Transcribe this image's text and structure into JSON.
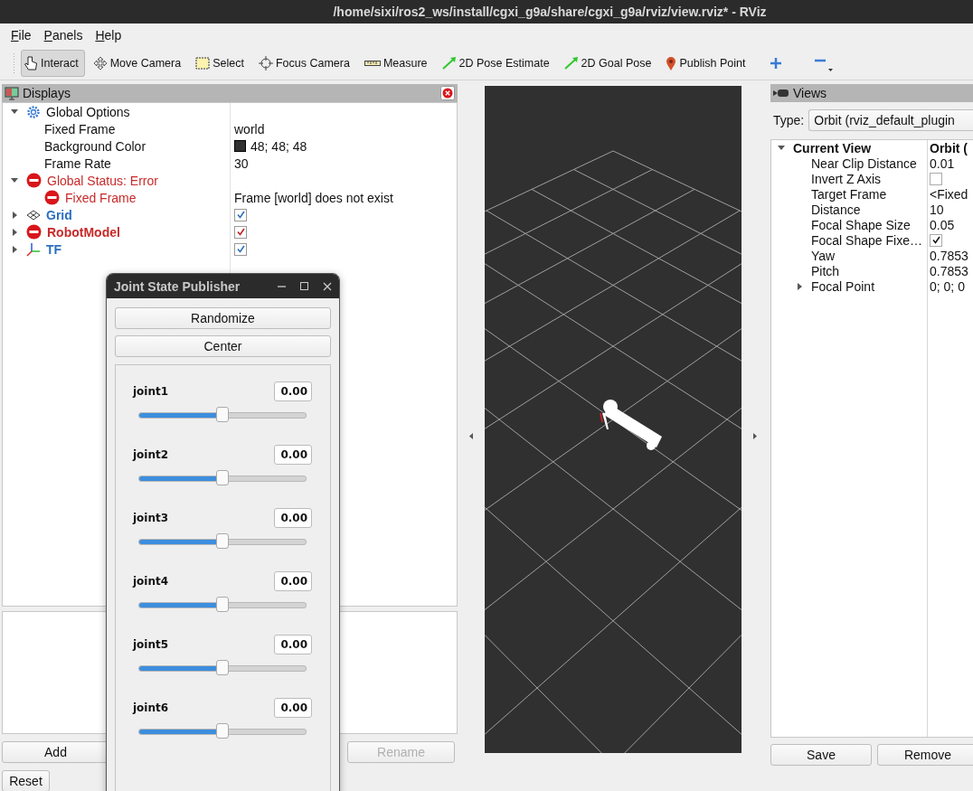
{
  "window": {
    "title": "/home/sixi/ros2_ws/install/cgxi_g9a/share/cgxi_g9a/rviz/view.rviz* - RViz"
  },
  "menu": [
    "File",
    "Panels",
    "Help"
  ],
  "tools": [
    {
      "label": "Interact",
      "kind": "interact",
      "selected": true
    },
    {
      "label": "Move Camera",
      "kind": "move_camera",
      "selected": false
    },
    {
      "label": "Select",
      "kind": "select",
      "selected": false
    },
    {
      "label": "Focus Camera",
      "kind": "focus_camera",
      "selected": false
    },
    {
      "label": "Measure",
      "kind": "measure",
      "selected": false
    },
    {
      "label": "2D Pose Estimate",
      "kind": "pose",
      "selected": false
    },
    {
      "label": "2D Goal Pose",
      "kind": "pose",
      "selected": false
    },
    {
      "label": "Publish Point",
      "kind": "point",
      "selected": false
    }
  ],
  "displays": {
    "title": "Displays",
    "tree": [
      {
        "name": "Global Options",
        "kind": "options",
        "expanded": true,
        "children": [
          {
            "name": "Fixed Frame",
            "value": "world"
          },
          {
            "name": "Background Color",
            "value": "48; 48; 48",
            "color": "#303030"
          },
          {
            "name": "Frame Rate",
            "value": "30"
          }
        ]
      },
      {
        "name": "Global Status: Error",
        "kind": "status",
        "error": true,
        "expanded": true,
        "children": [
          {
            "name": "Fixed Frame",
            "kind": "status",
            "error": true,
            "value": "Frame [world] does not exist"
          }
        ]
      },
      {
        "name": "Grid",
        "kind": "grid",
        "error": false,
        "expanded": false,
        "checked": true
      },
      {
        "name": "RobotModel",
        "kind": "robot_model",
        "error": true,
        "expanded": false,
        "checked": true
      },
      {
        "name": "TF",
        "kind": "tf",
        "error": false,
        "expanded": false,
        "checked": true
      }
    ],
    "buttons": [
      {
        "label": "Add",
        "disabled": false
      },
      {
        "label": "Rename",
        "disabled": true
      }
    ],
    "reset": "Reset"
  },
  "views": {
    "title": "Views",
    "type_label": "Type:",
    "type_value": "Orbit (rviz_default_plugin",
    "tree": [
      {
        "name": "Current View",
        "value": "Orbit (",
        "expanded": true,
        "children": [
          {
            "name": "Near Clip Distance",
            "value": "0.01"
          },
          {
            "name": "Invert Z Axis",
            "checked": false
          },
          {
            "name": "Target Frame",
            "value": "<Fixed"
          },
          {
            "name": "Distance",
            "value": "10"
          },
          {
            "name": "Focal Shape Size",
            "value": "0.05"
          },
          {
            "name": "Focal Shape Fixe…",
            "checked": true
          },
          {
            "name": "Yaw",
            "value": "0.7853"
          },
          {
            "name": "Pitch",
            "value": "0.7853"
          },
          {
            "name": "Focal Point",
            "value": "0; 0; 0",
            "expanded": false
          }
        ]
      }
    ],
    "buttons": [
      "Save",
      "Remove"
    ]
  },
  "joint_state_publisher": {
    "title": "Joint State Publisher",
    "buttons": [
      "Randomize",
      "Center"
    ],
    "joints": [
      {
        "name": "joint1",
        "value": "0.00",
        "level": 0.5
      },
      {
        "name": "joint2",
        "value": "0.00",
        "level": 0.5
      },
      {
        "name": "joint3",
        "value": "0.00",
        "level": 0.5
      },
      {
        "name": "joint4",
        "value": "0.00",
        "level": 0.5
      },
      {
        "name": "joint5",
        "value": "0.00",
        "level": 0.5
      },
      {
        "name": "joint6",
        "value": "0.00",
        "level": 0.5
      }
    ]
  }
}
